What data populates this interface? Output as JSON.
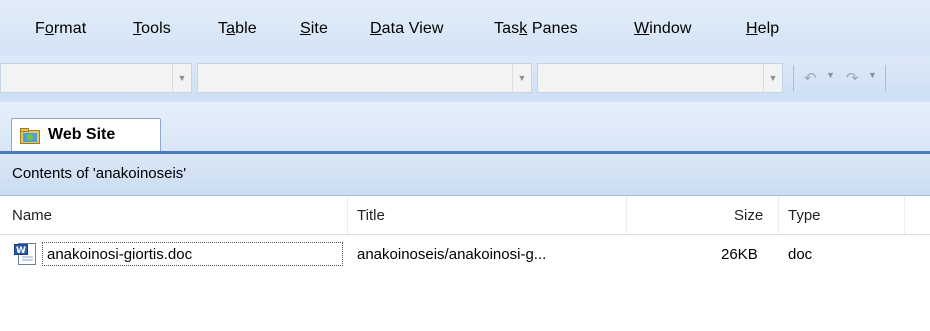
{
  "menu": {
    "items": [
      {
        "label": "Format",
        "hotkey_index": 1
      },
      {
        "label": "Tools",
        "hotkey_index": 0
      },
      {
        "label": "Table",
        "hotkey_index": 1
      },
      {
        "label": "Site",
        "hotkey_index": 0
      },
      {
        "label": "Data View",
        "hotkey_index": 0
      },
      {
        "label": "Task Panes",
        "hotkey_index": 3
      },
      {
        "label": "Window",
        "hotkey_index": 0
      },
      {
        "label": "Help",
        "hotkey_index": 0
      }
    ]
  },
  "toolbar": {
    "combo1_value": "",
    "combo2_value": "",
    "combo3_value": "",
    "undo_icon": "undo-icon",
    "redo_icon": "redo-icon"
  },
  "tabs": {
    "website_label": "Web Site",
    "website_icon": "folder-globe-icon"
  },
  "contents": {
    "title": "Contents of 'anakoinoseis'"
  },
  "table": {
    "columns": {
      "name": "Name",
      "title": "Title",
      "size": "Size",
      "type": "Type"
    },
    "rows": [
      {
        "icon": "word-document-icon",
        "name": "anakoinosi-giortis.doc",
        "title": "anakoinoseis/anakoinosi-g...",
        "size": "26KB",
        "type": "doc"
      }
    ]
  },
  "colors": {
    "tab_accent": "#4d7bc0",
    "menubar_bg": "#d3e3f6"
  }
}
